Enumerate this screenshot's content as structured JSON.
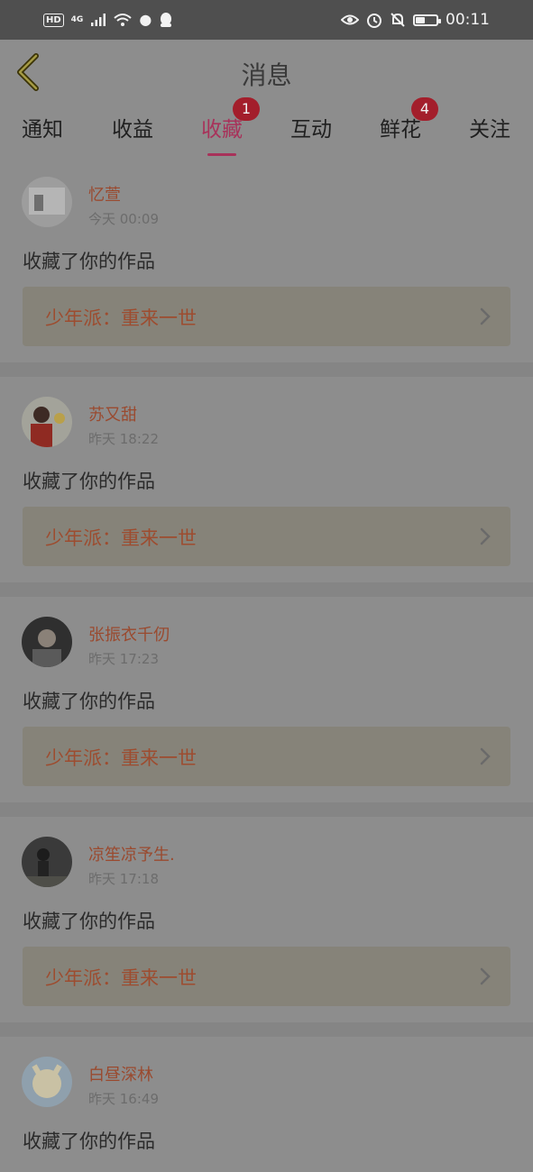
{
  "status_bar": {
    "left_badge": "HD",
    "network": "4G",
    "time": "00:11",
    "battery_level": 0.45,
    "icons": [
      "hd-icon",
      "signal-icon",
      "wifi-icon",
      "lightbulb-icon",
      "qq-icon",
      "eye-icon",
      "alarm-icon",
      "mute-bell-icon",
      "battery-icon"
    ]
  },
  "header": {
    "title": "消息",
    "back_icon": "back-chevron-icon"
  },
  "tabs": [
    {
      "label": "通知",
      "badge": null,
      "active": false
    },
    {
      "label": "收益",
      "badge": null,
      "active": false
    },
    {
      "label": "收藏",
      "badge": "1",
      "active": true
    },
    {
      "label": "互动",
      "badge": null,
      "active": false
    },
    {
      "label": "鲜花",
      "badge": "4",
      "active": false
    },
    {
      "label": "关注",
      "badge": null,
      "active": false
    }
  ],
  "messages": [
    {
      "name": "忆萱",
      "time": "今天 00:09",
      "action": "收藏了你的作品",
      "work": "少年派：重来一世"
    },
    {
      "name": "苏又甜",
      "time": "昨天 18:22",
      "action": "收藏了你的作品",
      "work": "少年派：重来一世"
    },
    {
      "name": "张振衣千仞",
      "time": "昨天 17:23",
      "action": "收藏了你的作品",
      "work": "少年派：重来一世"
    },
    {
      "name": "凉笙凉予生.",
      "time": "昨天 17:18",
      "action": "收藏了你的作品",
      "work": "少年派：重来一世"
    },
    {
      "name": "白昼深林",
      "time": "昨天 16:49",
      "action": "收藏了你的作品",
      "work": ""
    }
  ],
  "colors": {
    "accent": "#a8325a",
    "badge": "#a31e2b",
    "name": "#9a4a2f",
    "overlay_bg": "#8d8d8d"
  }
}
